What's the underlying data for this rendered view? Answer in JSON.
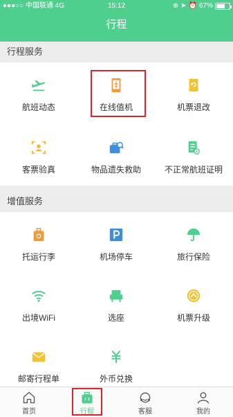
{
  "status_bar": {
    "carrier": "中国联通",
    "network": "4G",
    "time": "15:12",
    "battery_text": "67%",
    "battery_level": 0.67
  },
  "header": {
    "title": "行程"
  },
  "sections": [
    {
      "title": "行程服务",
      "items": [
        {
          "label": "航班动态",
          "icon": "airplane-icon"
        },
        {
          "label": "在线值机",
          "icon": "phone-checkin-icon"
        },
        {
          "label": "机票退改",
          "icon": "ticket-refund-icon"
        },
        {
          "label": "客票验真",
          "icon": "id-verify-icon"
        },
        {
          "label": "物品遗失救助",
          "icon": "lost-luggage-icon"
        },
        {
          "label": "不正常航班证明",
          "icon": "certificate-icon"
        }
      ]
    },
    {
      "title": "增值服务",
      "items": [
        {
          "label": "托运行李",
          "icon": "luggage-icon"
        },
        {
          "label": "机场停车",
          "icon": "parking-icon"
        },
        {
          "label": "旅行保险",
          "icon": "umbrella-icon"
        },
        {
          "label": "出境WiFi",
          "icon": "wifi-icon"
        },
        {
          "label": "选座",
          "icon": "seat-icon"
        },
        {
          "label": "机票升级",
          "icon": "upgrade-icon"
        },
        {
          "label": "邮寄行程单",
          "icon": "mail-icon"
        },
        {
          "label": "外币兑换",
          "icon": "currency-icon"
        }
      ]
    }
  ],
  "tabbar": [
    {
      "label": "首页",
      "icon": "home-icon"
    },
    {
      "label": "行程",
      "icon": "trip-bag-icon",
      "active": true
    },
    {
      "label": "客服",
      "icon": "headset-icon"
    },
    {
      "label": "我的",
      "icon": "user-icon"
    }
  ],
  "colors": {
    "brand": "#4fcf8d",
    "highlight": "#d9252b"
  }
}
